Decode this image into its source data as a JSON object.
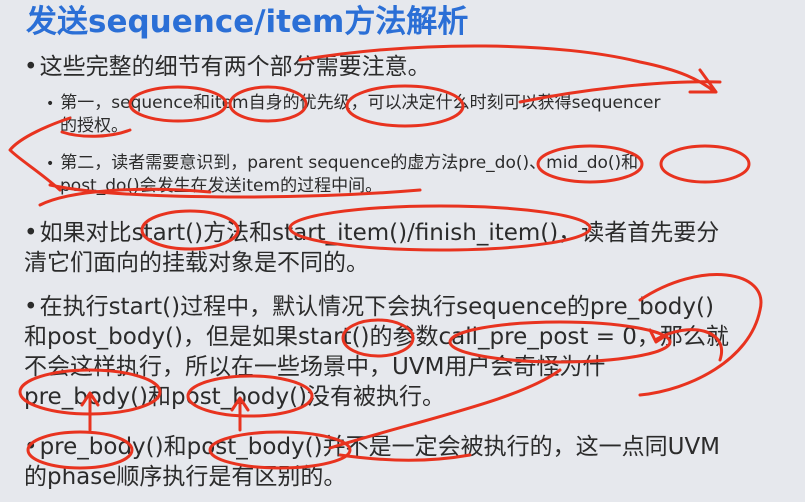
{
  "title": "发送sequence/item方法解析",
  "bullet_marker": "•",
  "sub_marker": "•",
  "points": [
    {
      "text": "这些完整的细节有两个部分需要注意。"
    },
    {
      "line1": "第一，sequence和item自身的优先级，可以决定什么时刻可以获得sequencer",
      "line2": "的授权。"
    },
    {
      "line1": "第二，读者需要意识到，parent sequence的虚方法pre_do()、mid_do()和",
      "line2": "post_do()会发生在发送item的过程中间。"
    },
    {
      "line1": "如果对比start()方法和start_item()/finish_item()，读者首先要分",
      "line2": "清它们面向的挂载对象是不同的。"
    },
    {
      "line1": "在执行start()过程中，默认情况下会执行sequence的pre_body()",
      "line2": "和post_body()，但是如果start()的参数call_pre_post = 0，那么就",
      "line3": "不会这样执行，所以在一些场景中，UVM用户会奇怪为什",
      "line4": "pre_body()和post_body()没有被执行。"
    },
    {
      "line1": "pre_body()和post_body()并不是一定会被执行的，这一点同UVM",
      "line2": "的phase顺序执行是有区别的。"
    }
  ],
  "annotation_color": "#e8331f",
  "title_color": "#2b6fd6"
}
